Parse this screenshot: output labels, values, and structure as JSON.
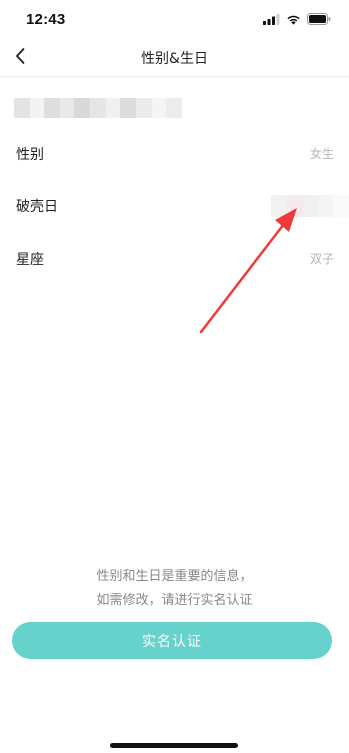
{
  "status_bar": {
    "time": "12:43",
    "icons": [
      "cellular-signal-icon",
      "wifi-icon",
      "battery-icon"
    ]
  },
  "nav": {
    "back_icon": "chevron-left-icon",
    "title": "性别&生日"
  },
  "rows": [
    {
      "label": "性别",
      "value": "女生"
    },
    {
      "label": "破壳日",
      "value": ""
    },
    {
      "label": "星座",
      "value": "双子"
    }
  ],
  "notice": {
    "line1": "性别和生日是重要的信息，",
    "line2": "如需修改，请进行实名认证"
  },
  "cta": {
    "label": "实名认证"
  },
  "colors": {
    "accent": "#66d2cc",
    "annotation_arrow": "#f03a3a",
    "muted_text": "#b4b4b4"
  }
}
